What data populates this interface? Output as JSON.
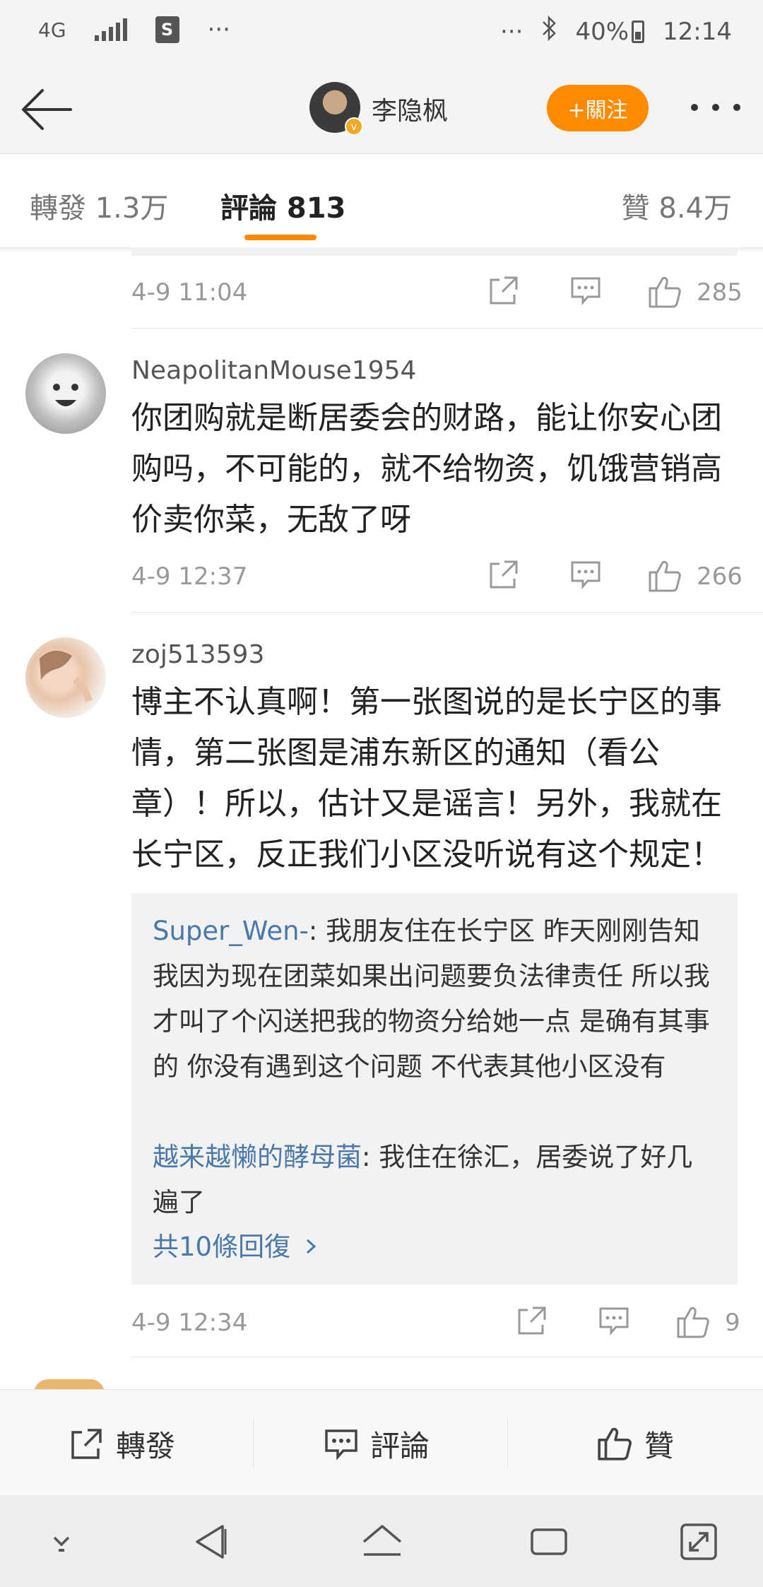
{
  "status_bar": {
    "network": "4G",
    "left_more": "···",
    "right_more": "···",
    "battery": "40%",
    "time": "12:14",
    "icons": [
      "signal-icon",
      "shop-icon",
      "bluetooth-icon",
      "battery-icon"
    ]
  },
  "header": {
    "author": "李隐枫",
    "follow_label": "+關注",
    "icons": [
      "back-arrow-icon",
      "verified-badge-icon",
      "more-dots-icon"
    ]
  },
  "tabs": [
    {
      "label": "轉發 1.3万"
    },
    {
      "label": "評論 813"
    },
    {
      "label": "贊 8.4万"
    }
  ],
  "accent_color": "#ff8a00",
  "comments": [
    {
      "time": "4-9 11:04",
      "likes": "285"
    },
    {
      "user": "NeapolitanMouse1954",
      "text": "你团购就是断居委会的财路，能让你安心团购吗，不可能的，就不给物资，饥饿营销高价卖你菜，无敌了呀",
      "time": "4-9 12:37",
      "likes": "266"
    },
    {
      "user": "zoj513593",
      "text": "博主不认真啊！第一张图说的是长宁区的事情，第二张图是浦东新区的通知（看公章）！所以，估计又是谣言！另外，我就在长宁区，反正我们小区没听说有这个规定！",
      "time": "4-9 12:34",
      "likes": "9",
      "replies": [
        {
          "user": "Super_Wen-",
          "text": ": 我朋友住在长宁区 昨天刚刚告知我因为现在团菜如果出问题要负法律责任 所以我才叫了个闪送把我的物资分给她一点 是确有其事的 你没有遇到这个问题 不代表其他小区没有"
        },
        {
          "user": "越来越懒的酵母菌",
          "text": ": 我住在徐汇，居委说了好几遍了"
        }
      ],
      "more_replies": "共10條回復"
    }
  ],
  "bottom_bar": {
    "repost": "轉發",
    "comment": "評論",
    "like": "贊"
  },
  "nav_bar": {
    "icons": [
      "hide-keyboard-icon",
      "back-triangle-icon",
      "home-icon",
      "recents-icon",
      "expand-icon"
    ]
  }
}
